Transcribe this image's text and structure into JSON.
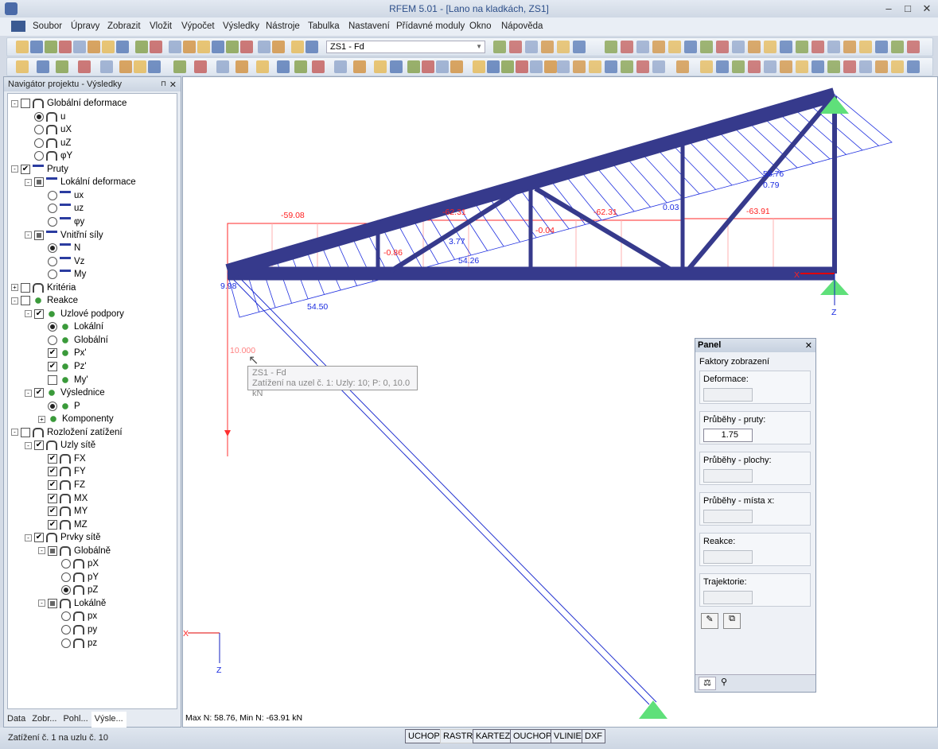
{
  "window": {
    "title": "RFEM 5.01 - [Lano na kladkách, ZS1]"
  },
  "menu": [
    "Soubor",
    "Úpravy",
    "Zobrazit",
    "Vložit",
    "Výpočet",
    "Výsledky",
    "Nástroje",
    "Tabulka",
    "Nastavení",
    "Přídavné moduly",
    "Okno",
    "Nápověda"
  ],
  "toolbar": {
    "load_case": "ZS1 - Fd"
  },
  "navigator": {
    "title": "Navigátor projektu - Výsledky",
    "items": [
      {
        "label": "Globální deformace",
        "level": 0,
        "exp": "-",
        "ctl": "check",
        "on": false,
        "icon": "frame"
      },
      {
        "label": "u",
        "level": 1,
        "ctl": "radio",
        "on": true,
        "icon": "frame"
      },
      {
        "label": "uX",
        "level": 1,
        "ctl": "radio",
        "on": false,
        "icon": "frame"
      },
      {
        "label": "uZ",
        "level": 1,
        "ctl": "radio",
        "on": false,
        "icon": "frame"
      },
      {
        "label": "φY",
        "level": 1,
        "ctl": "radio",
        "on": false,
        "icon": "frame"
      },
      {
        "label": "Pruty",
        "level": 0,
        "exp": "-",
        "ctl": "check",
        "on": true,
        "icon": "member"
      },
      {
        "label": "Lokální deformace",
        "level": 1,
        "exp": "-",
        "ctl": "partial",
        "on": false,
        "icon": "member"
      },
      {
        "label": "ux",
        "level": 2,
        "ctl": "radio",
        "on": false,
        "icon": "member"
      },
      {
        "label": "uz",
        "level": 2,
        "ctl": "radio",
        "on": false,
        "icon": "member"
      },
      {
        "label": "φy",
        "level": 2,
        "ctl": "radio",
        "on": false,
        "icon": "member"
      },
      {
        "label": "Vnitřní síly",
        "level": 1,
        "exp": "-",
        "ctl": "partial",
        "on": false,
        "icon": "member"
      },
      {
        "label": "N",
        "level": 2,
        "ctl": "radio",
        "on": true,
        "icon": "member"
      },
      {
        "label": "Vz",
        "level": 2,
        "ctl": "radio",
        "on": false,
        "icon": "member"
      },
      {
        "label": "My",
        "level": 2,
        "ctl": "radio",
        "on": false,
        "icon": "member"
      },
      {
        "label": "Kritéria",
        "level": 0,
        "exp": "+",
        "ctl": "check",
        "on": false,
        "icon": "frame"
      },
      {
        "label": "Reakce",
        "level": 0,
        "exp": "-",
        "ctl": "check",
        "on": false,
        "icon": "support"
      },
      {
        "label": "Uzlové podpory",
        "level": 1,
        "exp": "-",
        "ctl": "check",
        "on": true,
        "icon": "support"
      },
      {
        "label": "Lokální",
        "level": 2,
        "ctl": "radio",
        "on": true,
        "icon": "support"
      },
      {
        "label": "Globální",
        "level": 2,
        "ctl": "radio",
        "on": false,
        "icon": "support"
      },
      {
        "label": "Px'",
        "level": 2,
        "ctl": "check",
        "on": true,
        "icon": "support"
      },
      {
        "label": "Pz'",
        "level": 2,
        "ctl": "check",
        "on": true,
        "icon": "support"
      },
      {
        "label": "My'",
        "level": 2,
        "ctl": "check",
        "on": false,
        "icon": "support"
      },
      {
        "label": "Výslednice",
        "level": 1,
        "exp": "-",
        "ctl": "check",
        "on": true,
        "icon": "support"
      },
      {
        "label": "P",
        "level": 2,
        "ctl": "radio",
        "on": true,
        "icon": "support"
      },
      {
        "label": "Komponenty",
        "level": 2,
        "exp": "+",
        "ctl": "none",
        "on": false,
        "icon": "support"
      },
      {
        "label": "Rozložení zatížení",
        "level": 0,
        "exp": "-",
        "ctl": "check",
        "on": false,
        "icon": "frame"
      },
      {
        "label": "Uzly sítě",
        "level": 1,
        "exp": "-",
        "ctl": "check",
        "on": true,
        "icon": "frame"
      },
      {
        "label": "FX",
        "level": 2,
        "ctl": "check",
        "on": true,
        "icon": "frame"
      },
      {
        "label": "FY",
        "level": 2,
        "ctl": "check",
        "on": true,
        "icon": "frame"
      },
      {
        "label": "FZ",
        "level": 2,
        "ctl": "check",
        "on": true,
        "icon": "frame"
      },
      {
        "label": "MX",
        "level": 2,
        "ctl": "check",
        "on": true,
        "icon": "frame"
      },
      {
        "label": "MY",
        "level": 2,
        "ctl": "check",
        "on": true,
        "icon": "frame"
      },
      {
        "label": "MZ",
        "level": 2,
        "ctl": "check",
        "on": true,
        "icon": "frame"
      },
      {
        "label": "Prvky sítě",
        "level": 1,
        "exp": "-",
        "ctl": "check",
        "on": true,
        "icon": "frame"
      },
      {
        "label": "Globálně",
        "level": 2,
        "exp": "-",
        "ctl": "partial",
        "on": false,
        "icon": "frame"
      },
      {
        "label": "pX",
        "level": 3,
        "ctl": "radio",
        "on": false,
        "icon": "frame"
      },
      {
        "label": "pY",
        "level": 3,
        "ctl": "radio",
        "on": false,
        "icon": "frame"
      },
      {
        "label": "pZ",
        "level": 3,
        "ctl": "radio",
        "on": true,
        "icon": "frame"
      },
      {
        "label": "Lokálně",
        "level": 2,
        "exp": "-",
        "ctl": "partial",
        "on": false,
        "icon": "frame"
      },
      {
        "label": "px",
        "level": 3,
        "ctl": "radio",
        "on": false,
        "icon": "frame"
      },
      {
        "label": "py",
        "level": 3,
        "ctl": "radio",
        "on": false,
        "icon": "frame"
      },
      {
        "label": "pz",
        "level": 3,
        "ctl": "radio",
        "on": false,
        "icon": "frame"
      }
    ],
    "tabs": [
      "Data",
      "Zobr...",
      "Pohl...",
      "Výsle..."
    ]
  },
  "viewport": {
    "summary": "Max N: 58.76, Min N: -63.91 kN",
    "labels_red": [
      "-59.08",
      "-62.31",
      "-62.31",
      "-63.91",
      "-0.86",
      "-0.04",
      "10.000"
    ],
    "labels_blue": [
      "58.76",
      "0.79",
      "0.03",
      "3.77",
      "54.26",
      "54.50",
      "9.98"
    ],
    "axis_x": "X",
    "axis_z": "Z",
    "tooltip": {
      "line1": "ZS1 - Fd",
      "line2": "Zatížení na uzel č. 1: Uzly: 10; P: 0, 10.0 kN"
    }
  },
  "panel": {
    "title": "Panel",
    "heading": "Faktory zobrazení",
    "groups": [
      {
        "label": "Deformace:",
        "value": ""
      },
      {
        "label": "Průběhy - pruty:",
        "value": "1.75"
      },
      {
        "label": "Průběhy - plochy:",
        "value": ""
      },
      {
        "label": "Průběhy - místa x:",
        "value": ""
      },
      {
        "label": "Reakce:",
        "value": ""
      },
      {
        "label": "Trajektorie:",
        "value": ""
      }
    ]
  },
  "status": {
    "text": "Zatížení č. 1 na uzlu č. 10",
    "buttons": [
      "UCHOP",
      "RASTR",
      "KARTEZ",
      "OUCHOP",
      "VLINIE",
      "DXF"
    ]
  },
  "colors": {
    "member": "#363a8c",
    "n_negative": "#ff2020",
    "n_positive": "#1a2be0",
    "support": "#5fe07a"
  }
}
